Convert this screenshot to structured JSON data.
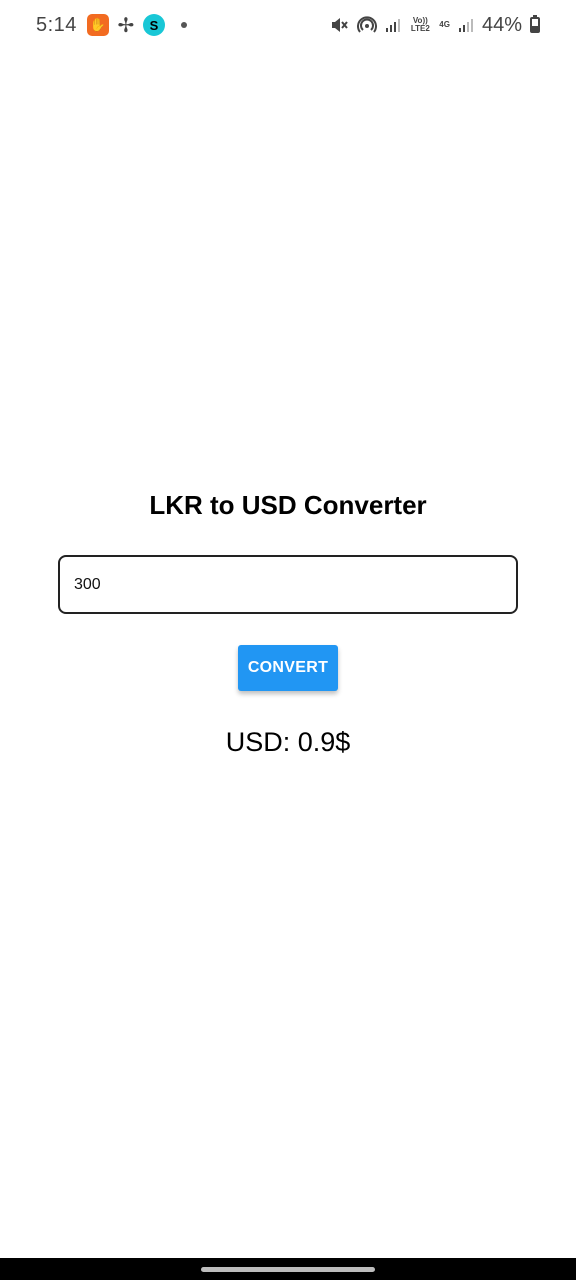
{
  "status_bar": {
    "time": "5:14",
    "apps": [
      {
        "icon": "orange-app-icon",
        "glyph": "✋"
      },
      {
        "icon": "pinwheel-app-icon",
        "glyph": "✢"
      },
      {
        "icon": "swap-app-icon",
        "glyph": "S"
      }
    ],
    "volte_label": "Vo)) LTE2",
    "network_label": "4G",
    "battery_percent": "44%",
    "battery_level": 0.44
  },
  "converter": {
    "title": "LKR to USD Converter",
    "input_value": "300",
    "button_label": "CONVERT",
    "result_text": "USD: 0.9$"
  },
  "colors": {
    "accent": "#2196f3",
    "nav_bar": "#000000"
  }
}
